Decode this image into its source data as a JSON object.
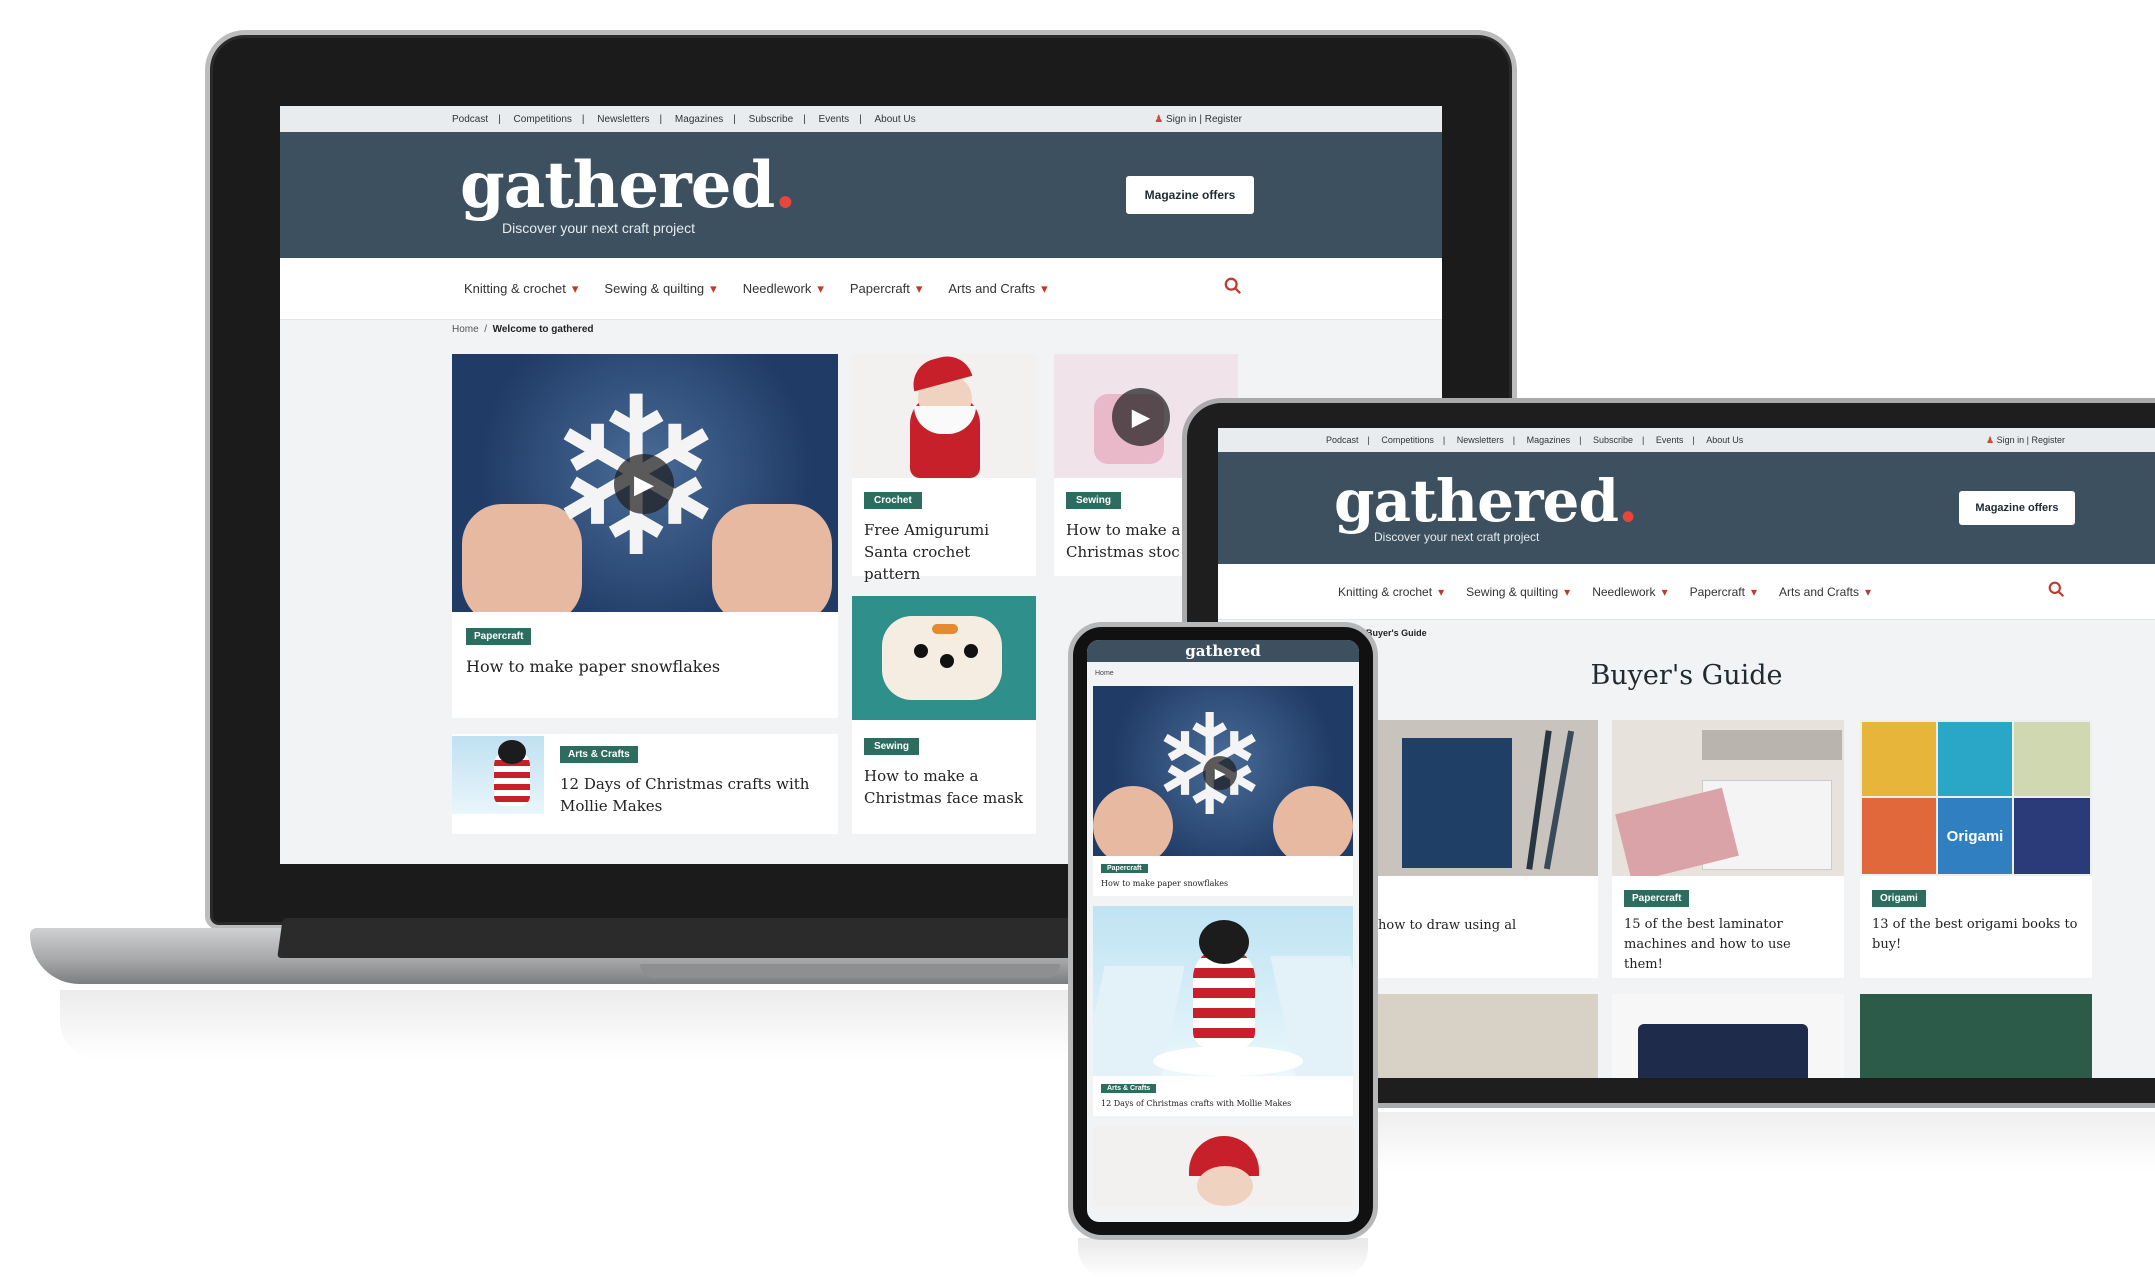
{
  "site": {
    "top_links": [
      "Podcast",
      "Competitions",
      "Newsletters",
      "Magazines",
      "Subscribe",
      "Events",
      "About Us"
    ],
    "sign_in": "Sign in",
    "register": "Register",
    "logo": "gathered",
    "logo_dot": ".",
    "tagline": "Discover your next craft project",
    "offers": "Magazine offers",
    "nav": [
      "Knitting & crochet",
      "Sewing & quilting",
      "Needlework",
      "Papercraft",
      "Arts and Crafts"
    ],
    "search_icon": "search-icon",
    "colors": {
      "masthead": "#3d5060",
      "tag": "#2d6d5f",
      "accent": "#e8453c"
    }
  },
  "laptop": {
    "breadcrumb_home": "Home",
    "breadcrumb_current": "Welcome to gathered",
    "feature": {
      "tag": "Papercraft",
      "title": "How to make paper snowflakes"
    },
    "cards": [
      {
        "tag": "Crochet",
        "title": "Free Amigurumi Santa crochet pattern"
      },
      {
        "tag": "Sewing",
        "title": "How to make a Christmas stoc"
      },
      {
        "tag": "Sewing",
        "title": "How to make a Christmas face mask"
      }
    ],
    "wide": {
      "tag": "Arts & Crafts",
      "title": "12 Days of Christmas crafts with Mollie Makes"
    }
  },
  "tablet": {
    "breadcrumb": "Buyer's Guide",
    "heading": "Buyer's Guide",
    "cards": [
      {
        "tag": "",
        "title": "how to draw using al"
      },
      {
        "tag": "Papercraft",
        "title": "15 of the best laminator machines and how to use them!"
      },
      {
        "tag": "Origami",
        "title": "13 of the best origami books to buy!"
      }
    ],
    "book_label": "Origami"
  },
  "phone": {
    "logo": "gathered",
    "breadcrumb": "Home",
    "cards": [
      {
        "tag": "Papercraft",
        "title": "How to make paper snowflakes"
      },
      {
        "tag": "Arts & Crafts",
        "title": "12 Days of Christmas crafts with Mollie Makes"
      }
    ]
  }
}
